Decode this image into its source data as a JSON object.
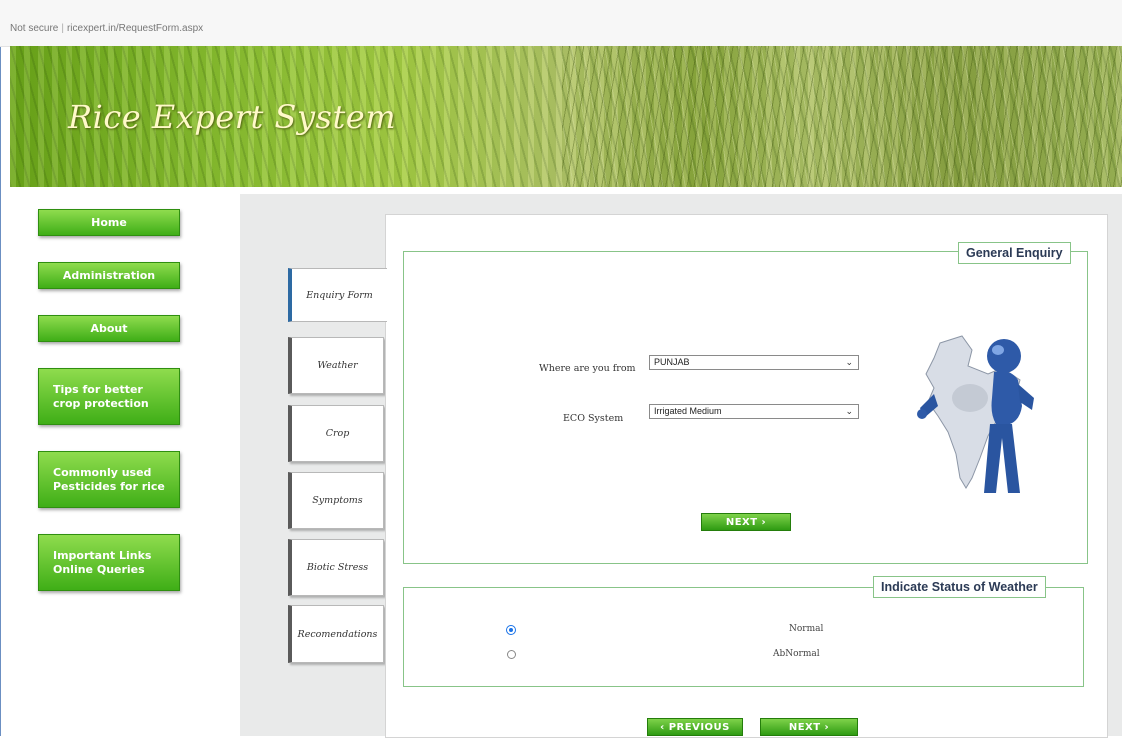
{
  "browser": {
    "security": "Not secure",
    "url": "ricexpert.in/RequestForm.aspx"
  },
  "banner": {
    "title": "Rice Expert System"
  },
  "nav": {
    "home": "Home",
    "administration": "Administration",
    "about": "About",
    "tips_1": "Tips for better",
    "tips_2": "crop protection",
    "pesticides_1": "Commonly used",
    "pesticides_2": "Pesticides for rice",
    "links_1": "Important Links",
    "links_2": "Online Queries"
  },
  "tabs": {
    "enquiry": "Enquiry Form",
    "weather": "Weather",
    "crop": "Crop",
    "symptoms": "Symptoms",
    "biotic": "Biotic Stress",
    "recommendations": "Recomendations"
  },
  "general_enquiry": {
    "legend": "General Enquiry",
    "location_label": "Where are you from",
    "location_value": "PUNJAB",
    "eco_label": "ECO System",
    "eco_value": "Irrigated Medium",
    "next_label": "NEXT ›"
  },
  "weather_status": {
    "legend": "Indicate Status of Weather",
    "option_normal": "Normal",
    "option_abnormal": "AbNormal",
    "selected": "Normal"
  },
  "footer_buttons": {
    "previous": "‹ PREVIOUS",
    "next": "NEXT ›"
  },
  "colors": {
    "nav_green": "#3fae17",
    "legend_border": "#88c488",
    "radio_selected": "#1a73e8"
  },
  "icons": {
    "figure": "person-holding-india-map-icon",
    "dropdown": "chevron-down-icon"
  }
}
